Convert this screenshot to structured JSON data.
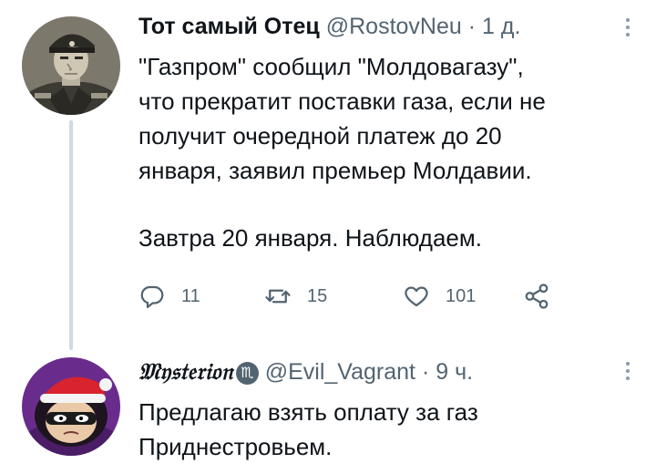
{
  "tweets": [
    {
      "author": {
        "display_name": "Тот самый Отец",
        "handle": "@RostovNeu",
        "separator": "·",
        "time": "1 д."
      },
      "text": "\"Газпром\" сообщил \"Молдовагазу\",\nчто прекратит поставки газа, если не\nполучит очередной платеж до 20\nянваря, заявил премьер Молдавии.",
      "text_2": "Завтра 20 января. Наблюдаем.",
      "stats": {
        "replies": "11",
        "retweets": "15",
        "likes": "101"
      }
    },
    {
      "author": {
        "display_name": "𝔐𝔶𝔰𝔱𝔢𝔯𝔦𝔬𝔫",
        "name_symbol": "♏",
        "handle": "@Evil_Vagrant",
        "separator": "·",
        "time": "9 ч."
      },
      "text": "Предлагаю взять оплату за газ\nПриднестровьем."
    }
  ],
  "icons": [
    "reply-icon",
    "retweet-icon",
    "like-icon",
    "share-icon",
    "more-options-icon"
  ],
  "colors": {
    "text": "#0f1419",
    "secondary": "#536471",
    "thread_line": "#cfd9de",
    "background": "#ffffff"
  }
}
